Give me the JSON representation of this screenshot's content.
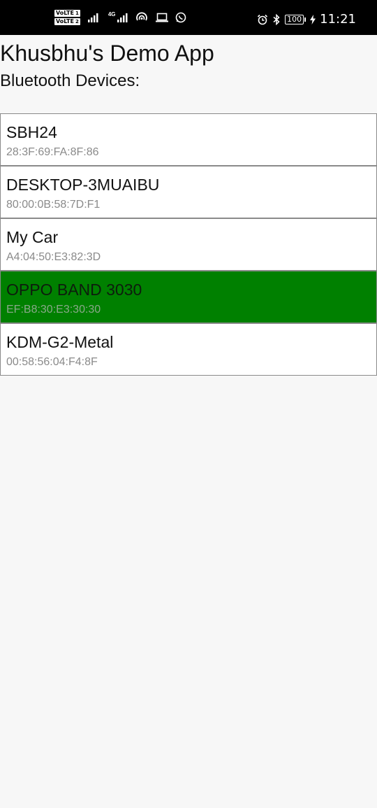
{
  "status_bar": {
    "volte_label": "VoLTE",
    "sim1": "1",
    "sim2": "2",
    "network_type": "4G",
    "battery": "100",
    "time": "11:21",
    "icons": [
      "signal-icon",
      "wifi-hotspot-icon",
      "laptop-icon",
      "whatsapp-icon",
      "alarm-icon",
      "bluetooth-icon",
      "battery-icon",
      "charging-icon"
    ]
  },
  "app": {
    "title": "Khusbhu's Demo App",
    "section_label": "Bluetooth Devices:"
  },
  "devices": [
    {
      "name": "SBH24",
      "address": "28:3F:69:FA:8F:86",
      "selected": false
    },
    {
      "name": "DESKTOP-3MUAIBU",
      "address": "80:00:0B:58:7D:F1",
      "selected": false
    },
    {
      "name": "My Car",
      "address": "A4:04:50:E3:82:3D",
      "selected": false
    },
    {
      "name": "OPPO BAND 3030",
      "address": "EF:B8:30:E3:30:30",
      "selected": true
    },
    {
      "name": "KDM-G2-Metal",
      "address": "00:58:56:04:F4:8F",
      "selected": false
    }
  ],
  "colors": {
    "status_bar_bg": "#000000",
    "page_bg": "#f7f7f7",
    "selected_bg": "#008000",
    "item_border": "#8a8a8a",
    "address_text": "#8a8a8a"
  }
}
